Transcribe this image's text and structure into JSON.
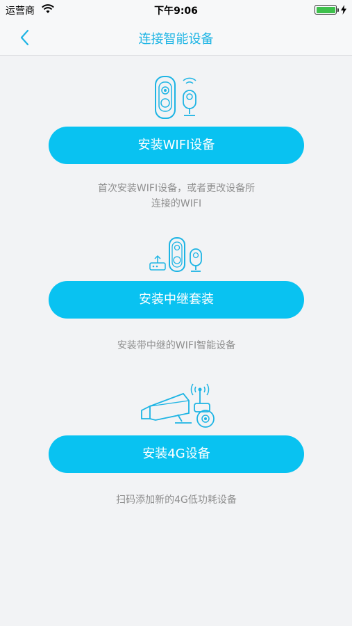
{
  "status_bar": {
    "carrier": "运营商",
    "time": "下午9:06",
    "battery_level": 1.0
  },
  "nav": {
    "title": "连接智能设备",
    "back_icon": "chevron-left-icon"
  },
  "colors": {
    "accent": "#1db4e4",
    "button": "#09c2f1",
    "background": "#f2f3f5",
    "desc_text": "#8e8e8e"
  },
  "options": [
    {
      "icon": "wifi-doorbell-camera-icon",
      "button_label": "安装WIFI设备",
      "desc_line1": "首次安装WIFI设备，或者更改设备所",
      "desc_line2": "连接的WIFI"
    },
    {
      "icon": "relay-kit-icon",
      "button_label": "安装中继套装",
      "desc_line1": "安装带中继的WIFI智能设备"
    },
    {
      "icon": "4g-camera-icon",
      "button_label": "安装4G设备",
      "desc_line1": "扫码添加新的4G低功耗设备"
    }
  ]
}
